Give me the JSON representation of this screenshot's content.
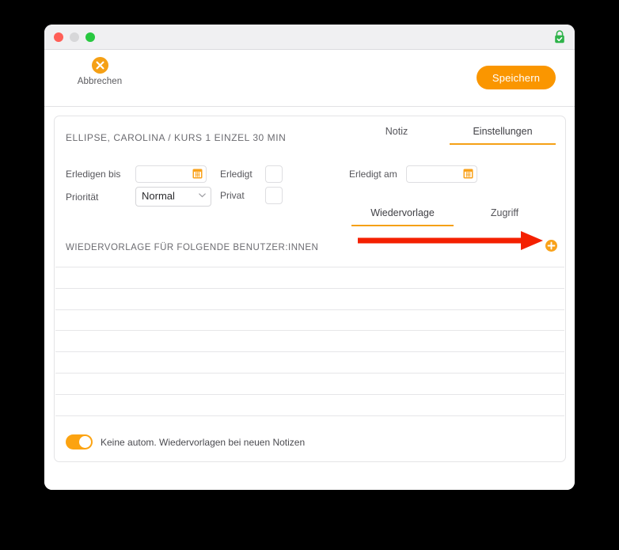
{
  "window": {
    "traffic_lights": [
      "close",
      "minimize",
      "maximize"
    ],
    "lock_icon": "lock-icon",
    "colors": {
      "accent_orange": "#fa9600",
      "tab_underline": "#f5a015",
      "toggle_on": "#fca311",
      "annotation_red": "#f42000",
      "lock_green": "#2fb34a",
      "light_red": "#ff5f57",
      "light_amber": "#d7d7d9",
      "light_green": "#28c840"
    }
  },
  "toolbar": {
    "cancel_label": "Abbrechen",
    "cancel_icon": "cancel-circle-x-icon",
    "save_label": "Speichern"
  },
  "record": {
    "title": "ELLIPSE, CAROLINA / KURS 1 EINZEL 30 MIN"
  },
  "top_tabs": [
    {
      "label": "Notiz",
      "active": false
    },
    {
      "label": "Einstellungen",
      "active": true
    }
  ],
  "sub_tabs": [
    {
      "label": "Wiedervorlage",
      "active": true
    },
    {
      "label": "Zugriff",
      "active": false
    }
  ],
  "form": {
    "due_date": {
      "label": "Erledigen bis",
      "value": "",
      "placeholder": "",
      "icon": "calendar-icon"
    },
    "priority": {
      "label": "Priorität",
      "value": "Normal",
      "options": [
        "Normal"
      ],
      "icon": "chevron-down-icon"
    },
    "done": {
      "label": "Erledigt",
      "checked": false
    },
    "private": {
      "label": "Privat",
      "checked": false
    },
    "done_on": {
      "label": "Erledigt am",
      "value": "",
      "placeholder": "",
      "icon": "calendar-icon"
    }
  },
  "section": {
    "heading": "WIEDERVORLAGE FÜR FOLGENDE BENUTZER:INNEN",
    "add_icon": "plus-circle-icon",
    "rows": [
      "",
      "",
      "",
      "",
      "",
      "",
      ""
    ]
  },
  "footer": {
    "toggle_on": true,
    "toggle_label": "Keine autom. Wiedervorlagen bei neuen Notizen"
  },
  "annotation": {
    "type": "arrow",
    "direction": "right",
    "points_to": "plus-circle-icon"
  }
}
